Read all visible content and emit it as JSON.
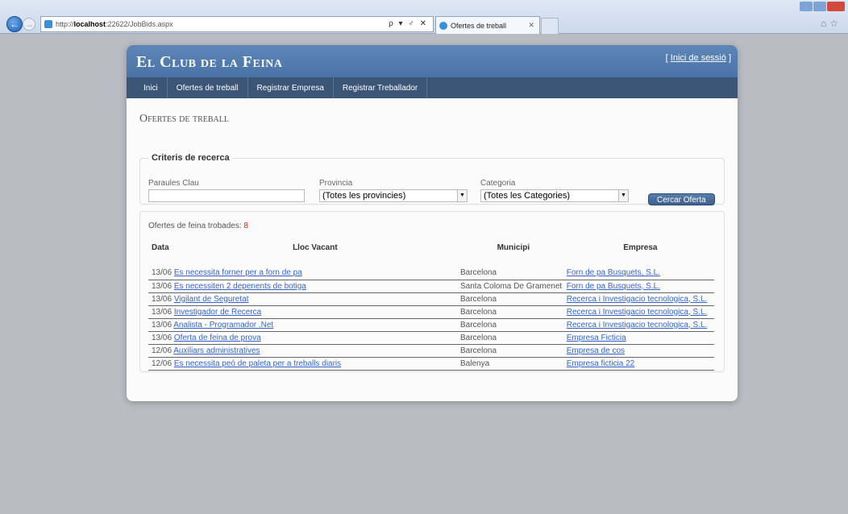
{
  "browser": {
    "address_prefix": "http://",
    "address_host": "localhost",
    "address_rest": ":22622/JobBids.aspx",
    "address_tools": "ρ ▾ ♂ ✕",
    "tab_title": "Ofertes de treball",
    "zoom": "125%"
  },
  "site": {
    "title": "El Club de la Feina",
    "login_link": "Inici de sessió",
    "login_open": "[",
    "login_close": "]"
  },
  "menu": [
    "Inici",
    "Ofertes de treball",
    "Registrar Empresa",
    "Registrar Treballador"
  ],
  "page_title": "Ofertes de treball",
  "criteria": {
    "legend": "Criteris de recerca",
    "keywords_label": "Paraules Clau",
    "keywords_value": "",
    "province_label": "Provincia",
    "province_value": "(Totes les provincies)",
    "category_label": "Categoria",
    "category_value": "(Totes les Categories)",
    "search_button": "Cercar Oferta"
  },
  "results": {
    "count_label": "Ofertes de feina trobades:",
    "count": "8",
    "headers": {
      "date": "Data",
      "job": "Lloc Vacant",
      "municipality": "Municipi",
      "company": "Empresa"
    },
    "rows": [
      {
        "date": "13/06",
        "job": "Es necessita forner per a forn de pa",
        "municipality": "Barcelona",
        "company": "Forn de pa Busquets, S.L."
      },
      {
        "date": "13/06",
        "job": "Es necessiten 2 depenents de botiga",
        "municipality": "Santa Coloma De Gramenet",
        "company": "Forn de pa Busquets, S.L."
      },
      {
        "date": "13/06",
        "job": "Vigilant de Seguretat",
        "municipality": "Barcelona",
        "company": "Recerca i Investigacio tecnologica, S.L."
      },
      {
        "date": "13/06",
        "job": "Investigador de Recerca",
        "municipality": "Barcelona",
        "company": "Recerca i Investigacio tecnologica, S.L."
      },
      {
        "date": "13/06",
        "job": "Analista - Programador .Net",
        "municipality": "Barcelona",
        "company": "Recerca i Investigacio tecnologica, S.L."
      },
      {
        "date": "13/06",
        "job": "Oferta de feina de prova",
        "municipality": "Barcelona",
        "company": "Empresa Ficticia"
      },
      {
        "date": "12/06",
        "job": "Auxiliars administratives",
        "municipality": "Barcelona",
        "company": "Empresa de cos"
      },
      {
        "date": "12/06",
        "job": "Es necessita peó de paleta per a treballs diaris",
        "municipality": "Balenya",
        "company": "Empresa ficticia 22"
      }
    ]
  }
}
